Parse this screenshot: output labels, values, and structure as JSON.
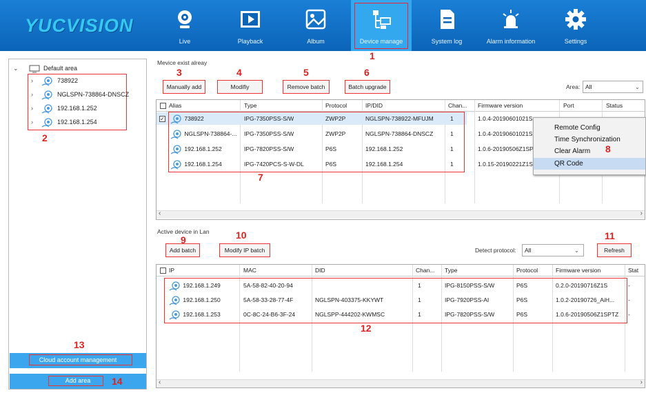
{
  "logo": "YUCVISION",
  "nav": [
    {
      "label": "Live",
      "icon": "camera-icon"
    },
    {
      "label": "Playback",
      "icon": "play-icon"
    },
    {
      "label": "Album",
      "icon": "image-icon"
    },
    {
      "label": "Device manage",
      "icon": "device-network-icon"
    },
    {
      "label": "System log",
      "icon": "document-icon"
    },
    {
      "label": "Alarm information",
      "icon": "alarm-icon"
    },
    {
      "label": "Settings",
      "icon": "gear-icon"
    }
  ],
  "annotations": [
    "1",
    "2",
    "3",
    "4",
    "5",
    "6",
    "7",
    "8",
    "9",
    "10",
    "11",
    "12",
    "13",
    "14"
  ],
  "tree": {
    "root": "Default area",
    "children": [
      "738922",
      "NGLSPN-738864-DNSCZ",
      "192.168.1.252",
      "192.168.1.254"
    ]
  },
  "left_buttons": {
    "cloud": "Cloud account management",
    "add_area": "Add area"
  },
  "existing": {
    "section_label": "Mevice exist alreay",
    "buttons": {
      "manual": "Manually add",
      "modify": "Modifiy",
      "remove": "Remove batch",
      "upgrade": "Batch upgrade"
    },
    "area_label": "Area:",
    "area_value": "All",
    "columns": [
      "Alias",
      "Type",
      "Protocol",
      "IP/DID",
      "Chan...",
      "Firmware version",
      "Port",
      "Status"
    ],
    "rows": [
      {
        "alias": "738922",
        "type": "IPG-7350PSS-S/W",
        "protocol": "ZWP2P",
        "ip": "NGLSPN-738922-MFUJM",
        "chan": "1",
        "fw": "1.0.4-20190601021S"
      },
      {
        "alias": "NGLSPN-738864-...",
        "type": "IPG-7350PSS-S/W",
        "protocol": "ZWP2P",
        "ip": "NGLSPN-738864-DNSCZ",
        "chan": "1",
        "fw": "1.0.4-20190601021S"
      },
      {
        "alias": "192.168.1.252",
        "type": "IPG-7820PSS-S/W",
        "protocol": "P6S",
        "ip": "192.168.1.252",
        "chan": "1",
        "fw": "1.0.6-20190506Z1SP"
      },
      {
        "alias": "192.168.1.254",
        "type": "IPG-7420PCS-S-W-DL",
        "protocol": "P6S",
        "ip": "192.168.1.254",
        "chan": "1",
        "fw": "1.0.15-20190221Z1S"
      }
    ]
  },
  "context_menu": [
    "Remote Config",
    "Time Synchronization",
    "Clear Alarm",
    "QR Code"
  ],
  "lan": {
    "section_label": "Active device in Lan",
    "buttons": {
      "add": "Add batch",
      "modify_ip": "Modify IP batch",
      "refresh": "Refresh"
    },
    "detect_label": "Detect protocol:",
    "detect_value": "All",
    "columns": [
      "IP",
      "MAC",
      "DID",
      "Chan...",
      "Type",
      "Protocol",
      "Firmware version",
      "Stat"
    ],
    "rows": [
      {
        "ip": "192.168.1.249",
        "mac": "5A-58-82-40-20-94",
        "did": "",
        "chan": "1",
        "type": "IPG-8150PSS-S/W",
        "protocol": "P6S",
        "fw": "0.2.0-20190716Z1S",
        "status": "-"
      },
      {
        "ip": "192.168.1.250",
        "mac": "5A-58-33-28-77-4F",
        "did": "NGLSPN-403375-KKYWT",
        "chan": "1",
        "type": "IPG-7920PSS-AI",
        "protocol": "P6S",
        "fw": "1.0.2-20190726_AiH...",
        "status": "-"
      },
      {
        "ip": "192.168.1.253",
        "mac": "0C-8C-24-B6-3F-24",
        "did": "NGLSPP-444202-KWMSC",
        "chan": "1",
        "type": "IPG-7820PSS-S/W",
        "protocol": "P6S",
        "fw": "1.0.6-20190506Z1SPTZ",
        "status": "-"
      }
    ]
  },
  "colors": {
    "topbar": "#0b64b8",
    "active_tab": "#34a8ee",
    "annotation": "#dd2222",
    "button_blue": "#3ba6ee"
  }
}
